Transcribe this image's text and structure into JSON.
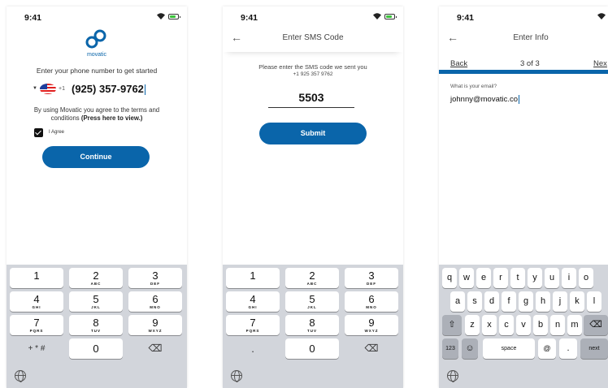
{
  "status": {
    "time": "9:41"
  },
  "screen1": {
    "brand": "movatic",
    "prompt": "Enter your phone number to get started",
    "country_code": "+1",
    "phone_number": "(925) 357-9762",
    "terms_text": "By using Movatic you agree to the terms and conditions",
    "terms_link": "(Press here to view.)",
    "agree_label": "I Agree",
    "continue_label": "Continue"
  },
  "screen2": {
    "title": "Enter SMS Code",
    "prompt": "Please enter the SMS code we sent you",
    "number": "+1 925 357 9762",
    "code": "5503",
    "submit_label": "Submit"
  },
  "screen3": {
    "title": "Enter Info",
    "back_label": "Back",
    "step": "3 of 3",
    "next_label": "Nex",
    "progress": 1.0,
    "question": "What is your email?",
    "email": "johnny@movatic.co"
  },
  "keypad": {
    "keys": [
      {
        "num": "1",
        "letters": ""
      },
      {
        "num": "2",
        "letters": "ABC"
      },
      {
        "num": "3",
        "letters": "DEF"
      },
      {
        "num": "4",
        "letters": "GHI"
      },
      {
        "num": "5",
        "letters": "JKL"
      },
      {
        "num": "6",
        "letters": "MNO"
      },
      {
        "num": "7",
        "letters": "PQRS"
      },
      {
        "num": "8",
        "letters": "TUV"
      },
      {
        "num": "9",
        "letters": "WXYZ"
      },
      {
        "num": "0",
        "letters": ""
      }
    ],
    "symbols": "+ * #",
    "dot": ".",
    "delete_icon": "⌫"
  },
  "qwerty": {
    "row1": [
      "q",
      "w",
      "e",
      "r",
      "t",
      "y",
      "u",
      "i",
      "o"
    ],
    "row2": [
      "a",
      "s",
      "d",
      "f",
      "g",
      "h",
      "j",
      "k",
      "l"
    ],
    "row3": [
      "z",
      "x",
      "c",
      "v",
      "b",
      "n",
      "m"
    ],
    "shift_icon": "⇧",
    "num_key": "123",
    "emoji_icon": "☺",
    "space": "space",
    "at": "@",
    "period": ".",
    "next": "next"
  },
  "colors": {
    "accent": "#0a65aa"
  }
}
